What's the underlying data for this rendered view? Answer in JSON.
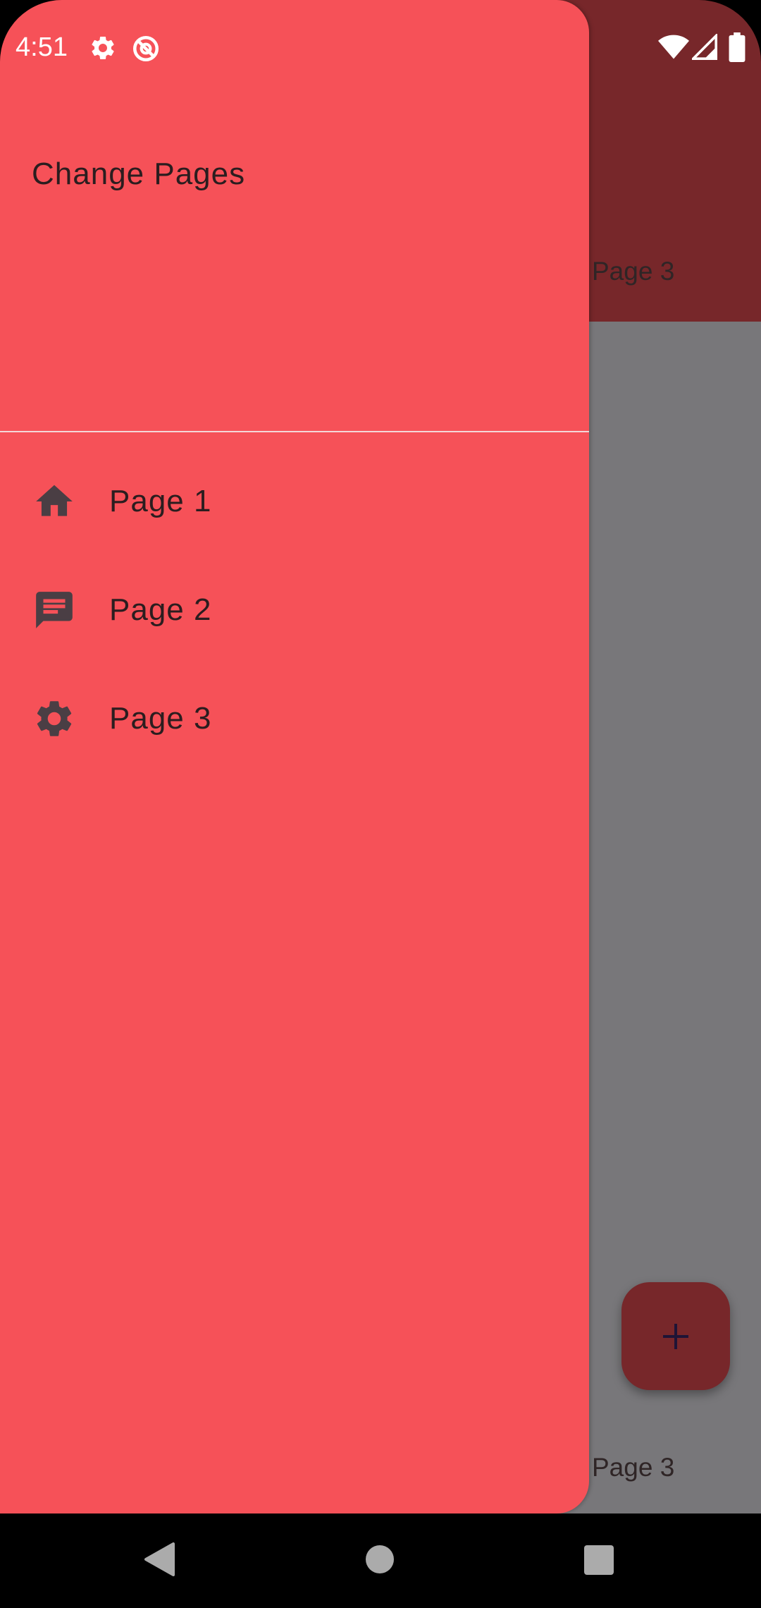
{
  "status_bar": {
    "time": "4:51",
    "left_icons": [
      "settings-gear-icon",
      "do-not-disturb-icon"
    ],
    "right_icons": [
      "wifi-icon",
      "cellular-signal-icon",
      "battery-icon"
    ]
  },
  "background_app": {
    "app_bar_title": "Page 3",
    "bottom_label": "Page 3",
    "fab_icon": "plus-icon",
    "colors": {
      "app_bar": "#77272A",
      "body": "#78777A",
      "fab": "#77272A"
    }
  },
  "drawer": {
    "header_title": "Change Pages",
    "background": "#F65158",
    "items": [
      {
        "label": "Page 1",
        "icon": "home-icon"
      },
      {
        "label": "Page 2",
        "icon": "message-icon"
      },
      {
        "label": "Page 3",
        "icon": "settings-icon"
      }
    ]
  },
  "system_nav": {
    "buttons": [
      "back-icon",
      "home-circle-icon",
      "recents-square-icon"
    ]
  }
}
